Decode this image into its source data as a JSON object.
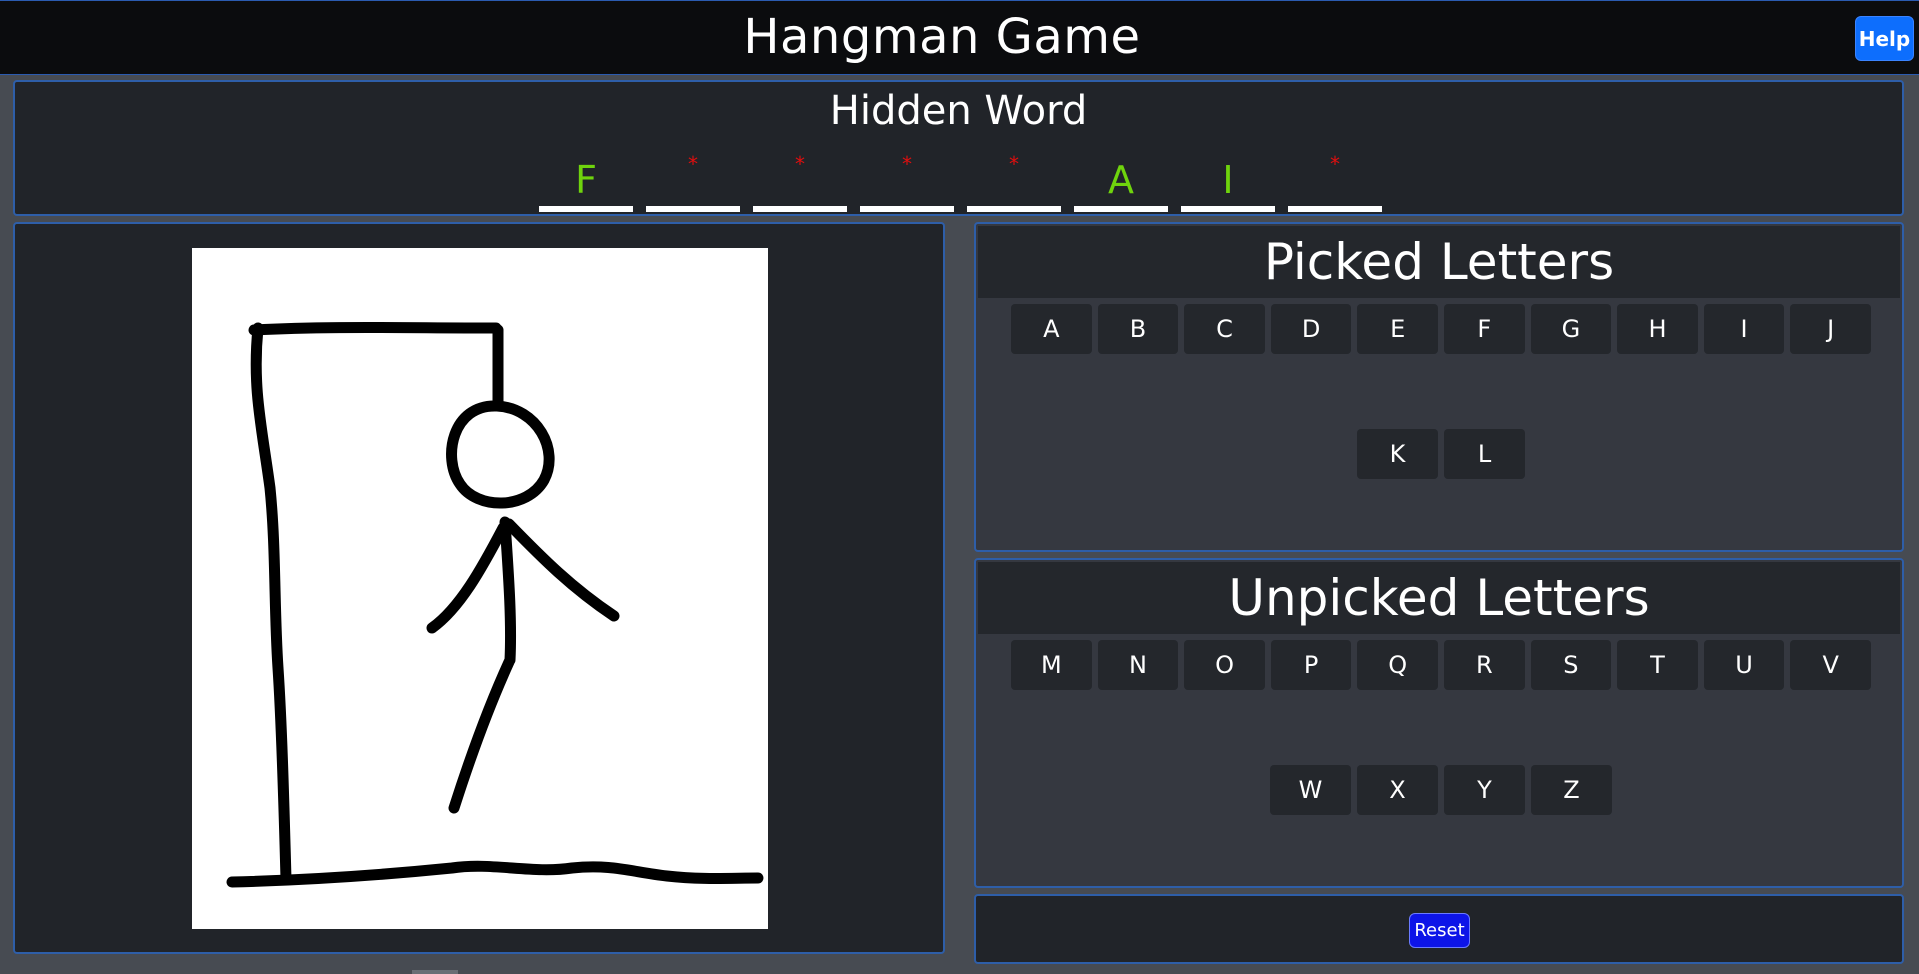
{
  "header": {
    "title": "Hangman Game",
    "help_label": "Help"
  },
  "hidden_word": {
    "title": "Hidden Word",
    "slots": [
      {
        "char": "F",
        "revealed": true
      },
      {
        "char": "*",
        "revealed": false
      },
      {
        "char": "*",
        "revealed": false
      },
      {
        "char": "*",
        "revealed": false
      },
      {
        "char": "*",
        "revealed": false
      },
      {
        "char": "A",
        "revealed": true
      },
      {
        "char": "I",
        "revealed": true
      },
      {
        "char": "*",
        "revealed": false
      }
    ]
  },
  "hangman_image": {
    "stage_parts": [
      "base",
      "pole",
      "beam",
      "rope",
      "head",
      "body",
      "left-arm",
      "right-arm",
      "left-leg"
    ]
  },
  "picked": {
    "title": "Picked Letters",
    "rows": [
      [
        "A",
        "B",
        "C",
        "D",
        "E",
        "F",
        "G",
        "H",
        "I",
        "J"
      ],
      [
        "K",
        "L"
      ]
    ]
  },
  "unpicked": {
    "title": "Unpicked Letters",
    "rows": [
      [
        "M",
        "N",
        "O",
        "P",
        "Q",
        "R",
        "S",
        "T",
        "U",
        "V"
      ],
      [
        "W",
        "X",
        "Y",
        "Z"
      ]
    ]
  },
  "controls": {
    "reset_label": "Reset"
  },
  "colors": {
    "revealed_letter": "#6fd40d",
    "masked_letter": "#e00e0e",
    "panel_border": "#2e5ea8",
    "help_button": "#0d6efd",
    "reset_button": "#0d14e8"
  }
}
